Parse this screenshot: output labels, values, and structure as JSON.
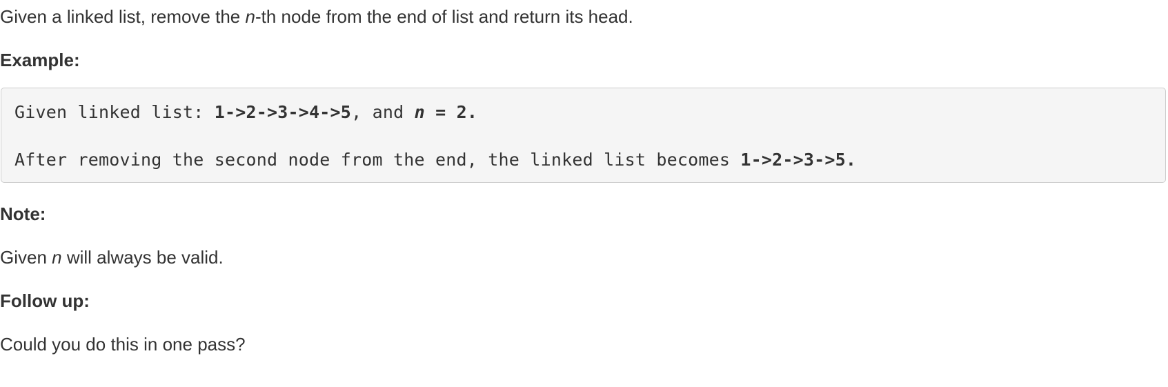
{
  "intro": {
    "part1": "Given a linked list, remove the ",
    "var": "n",
    "part2": "-th node from the end of list and return its head."
  },
  "example": {
    "heading": "Example:",
    "line1": {
      "prefix": "Given linked list: ",
      "list": "1->2->3->4->5",
      "middle": ", and ",
      "var": "n",
      "equals": " = ",
      "value": "2."
    },
    "line2": {
      "prefix": "After removing the second node from the end, the linked list becomes ",
      "result": "1->2->3->5."
    }
  },
  "note": {
    "heading": "Note:",
    "part1": "Given ",
    "var": "n",
    "part2": " will always be valid."
  },
  "followup": {
    "heading": "Follow up:",
    "text": "Could you do this in one pass?"
  }
}
